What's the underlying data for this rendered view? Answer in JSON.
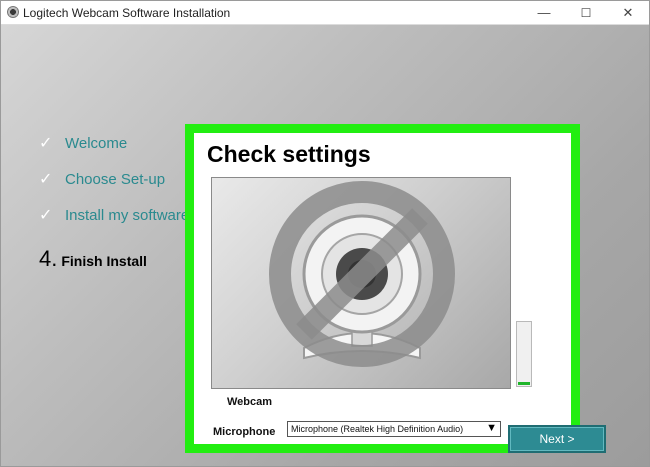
{
  "window": {
    "title": "Logitech Webcam Software Installation",
    "controls": {
      "minimize": "—",
      "maximize": "☐",
      "close": "✕"
    }
  },
  "steps": [
    {
      "label": "Welcome",
      "state": "done",
      "marker": "✓"
    },
    {
      "label": "Choose Set-up",
      "state": "done",
      "marker": "✓"
    },
    {
      "label": "Install my software",
      "state": "done",
      "marker": "✓"
    },
    {
      "label": "Finish Install",
      "state": "current",
      "marker": "4."
    }
  ],
  "dialog": {
    "title": "Check settings",
    "webcam_label": "Webcam",
    "webcam_preview_icon": "webcam-disabled-icon",
    "mic_level": 0.05,
    "microphone_label": "Microphone",
    "microphone_selected": "Microphone (Realtek High Definition Audio)",
    "highlight_color": "#22ee11"
  },
  "footer": {
    "next_label": "Next >",
    "accent_color": "#2d8b93"
  }
}
